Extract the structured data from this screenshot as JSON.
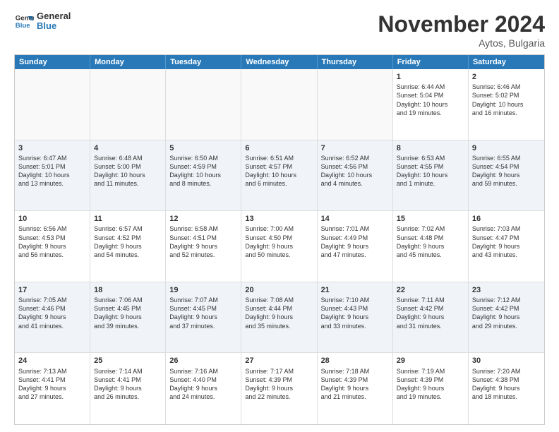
{
  "logo": {
    "line1": "General",
    "line2": "Blue"
  },
  "title": "November 2024",
  "location": "Aytos, Bulgaria",
  "days_of_week": [
    "Sunday",
    "Monday",
    "Tuesday",
    "Wednesday",
    "Thursday",
    "Friday",
    "Saturday"
  ],
  "weeks": [
    [
      {
        "day": "",
        "info": "",
        "empty": true
      },
      {
        "day": "",
        "info": "",
        "empty": true
      },
      {
        "day": "",
        "info": "",
        "empty": true
      },
      {
        "day": "",
        "info": "",
        "empty": true
      },
      {
        "day": "",
        "info": "",
        "empty": true
      },
      {
        "day": "1",
        "info": "Sunrise: 6:44 AM\nSunset: 5:04 PM\nDaylight: 10 hours\nand 19 minutes."
      },
      {
        "day": "2",
        "info": "Sunrise: 6:46 AM\nSunset: 5:02 PM\nDaylight: 10 hours\nand 16 minutes."
      }
    ],
    [
      {
        "day": "3",
        "info": "Sunrise: 6:47 AM\nSunset: 5:01 PM\nDaylight: 10 hours\nand 13 minutes."
      },
      {
        "day": "4",
        "info": "Sunrise: 6:48 AM\nSunset: 5:00 PM\nDaylight: 10 hours\nand 11 minutes."
      },
      {
        "day": "5",
        "info": "Sunrise: 6:50 AM\nSunset: 4:59 PM\nDaylight: 10 hours\nand 8 minutes."
      },
      {
        "day": "6",
        "info": "Sunrise: 6:51 AM\nSunset: 4:57 PM\nDaylight: 10 hours\nand 6 minutes."
      },
      {
        "day": "7",
        "info": "Sunrise: 6:52 AM\nSunset: 4:56 PM\nDaylight: 10 hours\nand 4 minutes."
      },
      {
        "day": "8",
        "info": "Sunrise: 6:53 AM\nSunset: 4:55 PM\nDaylight: 10 hours\nand 1 minute."
      },
      {
        "day": "9",
        "info": "Sunrise: 6:55 AM\nSunset: 4:54 PM\nDaylight: 9 hours\nand 59 minutes."
      }
    ],
    [
      {
        "day": "10",
        "info": "Sunrise: 6:56 AM\nSunset: 4:53 PM\nDaylight: 9 hours\nand 56 minutes."
      },
      {
        "day": "11",
        "info": "Sunrise: 6:57 AM\nSunset: 4:52 PM\nDaylight: 9 hours\nand 54 minutes."
      },
      {
        "day": "12",
        "info": "Sunrise: 6:58 AM\nSunset: 4:51 PM\nDaylight: 9 hours\nand 52 minutes."
      },
      {
        "day": "13",
        "info": "Sunrise: 7:00 AM\nSunset: 4:50 PM\nDaylight: 9 hours\nand 50 minutes."
      },
      {
        "day": "14",
        "info": "Sunrise: 7:01 AM\nSunset: 4:49 PM\nDaylight: 9 hours\nand 47 minutes."
      },
      {
        "day": "15",
        "info": "Sunrise: 7:02 AM\nSunset: 4:48 PM\nDaylight: 9 hours\nand 45 minutes."
      },
      {
        "day": "16",
        "info": "Sunrise: 7:03 AM\nSunset: 4:47 PM\nDaylight: 9 hours\nand 43 minutes."
      }
    ],
    [
      {
        "day": "17",
        "info": "Sunrise: 7:05 AM\nSunset: 4:46 PM\nDaylight: 9 hours\nand 41 minutes."
      },
      {
        "day": "18",
        "info": "Sunrise: 7:06 AM\nSunset: 4:45 PM\nDaylight: 9 hours\nand 39 minutes."
      },
      {
        "day": "19",
        "info": "Sunrise: 7:07 AM\nSunset: 4:45 PM\nDaylight: 9 hours\nand 37 minutes."
      },
      {
        "day": "20",
        "info": "Sunrise: 7:08 AM\nSunset: 4:44 PM\nDaylight: 9 hours\nand 35 minutes."
      },
      {
        "day": "21",
        "info": "Sunrise: 7:10 AM\nSunset: 4:43 PM\nDaylight: 9 hours\nand 33 minutes."
      },
      {
        "day": "22",
        "info": "Sunrise: 7:11 AM\nSunset: 4:42 PM\nDaylight: 9 hours\nand 31 minutes."
      },
      {
        "day": "23",
        "info": "Sunrise: 7:12 AM\nSunset: 4:42 PM\nDaylight: 9 hours\nand 29 minutes."
      }
    ],
    [
      {
        "day": "24",
        "info": "Sunrise: 7:13 AM\nSunset: 4:41 PM\nDaylight: 9 hours\nand 27 minutes."
      },
      {
        "day": "25",
        "info": "Sunrise: 7:14 AM\nSunset: 4:41 PM\nDaylight: 9 hours\nand 26 minutes."
      },
      {
        "day": "26",
        "info": "Sunrise: 7:16 AM\nSunset: 4:40 PM\nDaylight: 9 hours\nand 24 minutes."
      },
      {
        "day": "27",
        "info": "Sunrise: 7:17 AM\nSunset: 4:39 PM\nDaylight: 9 hours\nand 22 minutes."
      },
      {
        "day": "28",
        "info": "Sunrise: 7:18 AM\nSunset: 4:39 PM\nDaylight: 9 hours\nand 21 minutes."
      },
      {
        "day": "29",
        "info": "Sunrise: 7:19 AM\nSunset: 4:39 PM\nDaylight: 9 hours\nand 19 minutes."
      },
      {
        "day": "30",
        "info": "Sunrise: 7:20 AM\nSunset: 4:38 PM\nDaylight: 9 hours\nand 18 minutes."
      }
    ]
  ]
}
